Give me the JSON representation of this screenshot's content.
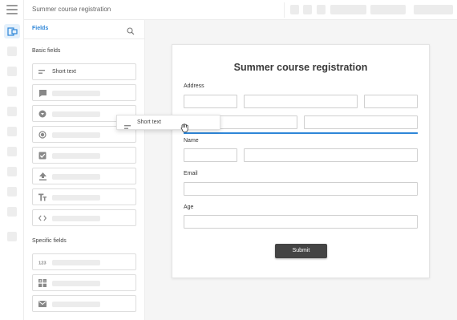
{
  "app": {
    "title": "Summer course registration"
  },
  "panel": {
    "header_label": "Fields",
    "basic_section": "Basic fields",
    "specific_section": "Specific fields",
    "short_text_label": "Short text"
  },
  "drag": {
    "label": "Short text"
  },
  "form": {
    "title": "Summer course registration",
    "address_label": "Address",
    "name_label": "Name",
    "email_label": "Email",
    "age_label": "Age",
    "submit_label": "Submit"
  },
  "icons": {
    "menu": "hamburger-icon",
    "forms": "form-builder-icon",
    "search": "search-icon",
    "short_text": "short-text-icon",
    "long_text": "paragraph-icon",
    "dropdown": "dropdown-icon",
    "radio": "radio-icon",
    "checkbox": "checkbox-icon",
    "upload": "upload-icon",
    "text_style": "text-style-icon",
    "code": "code-icon",
    "number": "number-icon",
    "calculator": "calculator-icon",
    "email": "email-icon"
  },
  "colors": {
    "accent": "#2e86d8",
    "submit_bg": "#444444",
    "canvas_bg": "#f5f5f5"
  }
}
